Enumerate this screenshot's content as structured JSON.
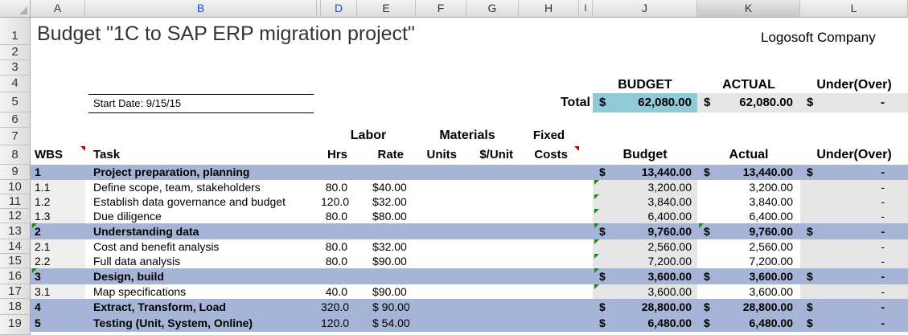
{
  "columns": [
    "A",
    "B",
    "D",
    "E",
    "F",
    "G",
    "H",
    "I",
    "J",
    "K",
    "L"
  ],
  "row_numbers": [
    "1",
    "2",
    "3",
    "4",
    "5",
    "6",
    "7",
    "8",
    "9",
    "10",
    "11",
    "12",
    "13",
    "14",
    "15",
    "16",
    "17",
    "18",
    "19"
  ],
  "title": "Budget \"1C to SAP ERP migration project\"",
  "company": "Logosoft Company",
  "start_date": "Start Date: 9/15/15",
  "summary": {
    "budget_header": "BUDGET",
    "actual_header": "ACTUAL",
    "under_header": "Under(Over)",
    "total_label": "Total",
    "currency": "$",
    "budget": "62,080.00",
    "actual": "62,080.00",
    "under": "-"
  },
  "headers": {
    "labor": "Labor",
    "materials": "Materials",
    "fixed": "Fixed",
    "wbs": "WBS",
    "task": "Task",
    "hrs": "Hrs",
    "rate": "Rate",
    "units": "Units",
    "per_unit": "$/Unit",
    "costs": "Costs",
    "budget": "Budget",
    "actual": "Actual",
    "under": "Under(Over)"
  },
  "rows": [
    {
      "wbs": "1",
      "task": "Project preparation, planning",
      "hrs": "",
      "rate": "",
      "cur": "$",
      "budget": "13,440.00",
      "cur2": "$",
      "actual": "13,440.00",
      "cur3": "$",
      "under": "-",
      "level": "phase"
    },
    {
      "wbs": "1.1",
      "task": "Define scope, team, stakeholders",
      "hrs": "80.0",
      "rate": "$40.00",
      "cur": "",
      "budget": "3,200.00",
      "cur2": "",
      "actual": "3,200.00",
      "cur3": "",
      "under": "-",
      "level": "task"
    },
    {
      "wbs": "1.2",
      "task": "Establish data governance and budget",
      "hrs": "120.0",
      "rate": "$32.00",
      "cur": "",
      "budget": "3,840.00",
      "cur2": "",
      "actual": "3,840.00",
      "cur3": "",
      "under": "-",
      "level": "task"
    },
    {
      "wbs": "1.3",
      "task": "Due diligence",
      "hrs": "80.0",
      "rate": "$80.00",
      "cur": "",
      "budget": "6,400.00",
      "cur2": "",
      "actual": "6,400.00",
      "cur3": "",
      "under": "-",
      "level": "task"
    },
    {
      "wbs": "2",
      "task": "Understanding data",
      "hrs": "",
      "rate": "",
      "cur": "$",
      "budget": "9,760.00",
      "cur2": "$",
      "actual": "9,760.00",
      "cur3": "$",
      "under": "-",
      "level": "phase"
    },
    {
      "wbs": "2.1",
      "task": "Cost and benefit analysis",
      "hrs": "80.0",
      "rate": "$32.00",
      "cur": "",
      "budget": "2,560.00",
      "cur2": "",
      "actual": "2,560.00",
      "cur3": "",
      "under": "-",
      "level": "task"
    },
    {
      "wbs": "2.2",
      "task": "Full data analysis",
      "hrs": "80.0",
      "rate": "$90.00",
      "cur": "",
      "budget": "7,200.00",
      "cur2": "",
      "actual": "7,200.00",
      "cur3": "",
      "under": "-",
      "level": "task"
    },
    {
      "wbs": "3",
      "task": "Design, build",
      "hrs": "",
      "rate": "",
      "cur": "$",
      "budget": "3,600.00",
      "cur2": "$",
      "actual": "3,600.00",
      "cur3": "$",
      "under": "-",
      "level": "phase"
    },
    {
      "wbs": "3.1",
      "task": "Map specifications",
      "hrs": "40.0",
      "rate": "$90.00",
      "cur": "",
      "budget": "3,600.00",
      "cur2": "",
      "actual": "3,600.00",
      "cur3": "",
      "under": "-",
      "level": "task"
    },
    {
      "wbs": "4",
      "task": "Extract, Transform, Load",
      "hrs": "320.0",
      "rate": "$ 90.00",
      "cur": "$",
      "budget": "28,800.00",
      "cur2": "$",
      "actual": "28,800.00",
      "cur3": "$",
      "under": "-",
      "level": "phase"
    },
    {
      "wbs": "5",
      "task": "Testing (Unit, System, Online)",
      "hrs": "120.0",
      "rate": "$ 54.00",
      "cur": "$",
      "budget": "6,480.00",
      "cur2": "$",
      "actual": "6,480.00",
      "cur3": "$",
      "under": "-",
      "level": "phase"
    }
  ],
  "colors": {
    "band": "#a5b4d7",
    "teal": "#8fcad6",
    "gray": "#e6e6e6",
    "comment_red": "#c00000",
    "green_flag": "#1b8a1b"
  }
}
